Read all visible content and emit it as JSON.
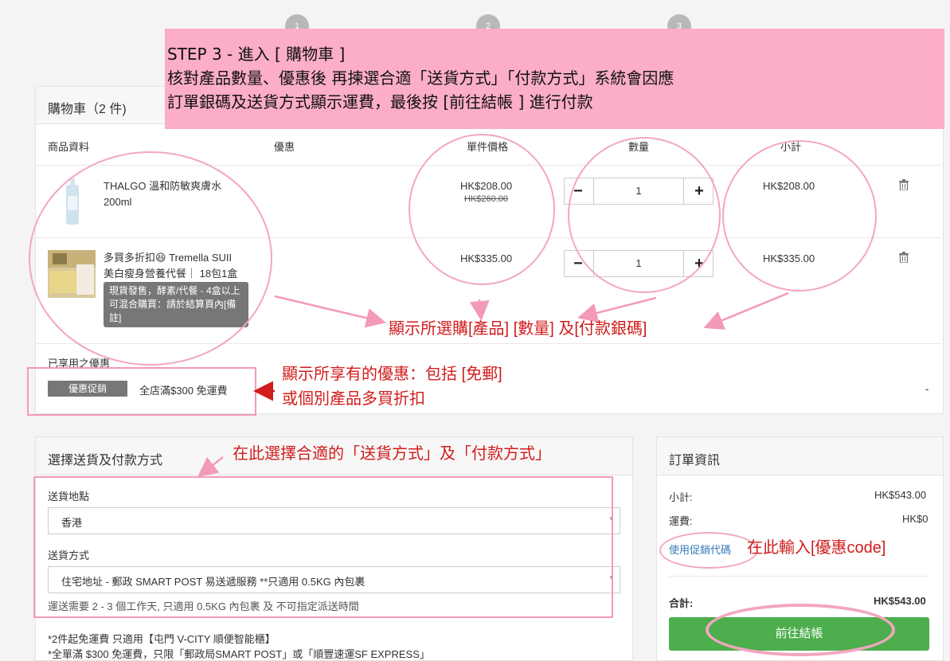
{
  "steps": [
    "1",
    "2",
    "3"
  ],
  "banner": {
    "line1": "STEP 3 - 進入 [ 購物車 ]",
    "line2": "核對產品數量、優惠後 再揀選合適「送貨方式」「付款方式」系統會因應",
    "line3": "訂單銀碼及送貨方式顯示運費，最後按 [前往結帳 ]  進行付款"
  },
  "cart": {
    "title": "購物車（2 件)",
    "col_product": "商品資料",
    "col_discount": "優惠",
    "col_unit_price": "單件價格",
    "col_qty": "數量",
    "col_subtotal": "小計",
    "items": [
      {
        "name": "THALGO 溫和防敏爽膚水 200ml",
        "price": "HK$208.00",
        "orig_price": "HK$260.00",
        "qty": "1",
        "subtotal": "HK$208.00"
      },
      {
        "name_line1": "多買多折扣😆 Tremella SUII",
        "name_line2": "美白瘦身營養代餐｜ 18包1盒",
        "tag": "現貨發售，酵素/代餐 - 4盒以上 可混合購買：請於結算頁內[備註]",
        "price": "HK$335.00",
        "qty": "1",
        "subtotal": "HK$335.00"
      }
    ],
    "applied_label": "已享用之優惠",
    "promo_button": "優惠促銷",
    "promo_text": "全店滿$300 免運費",
    "promo_value": "-"
  },
  "shipping": {
    "title": "選擇送貨及付款方式",
    "location_label": "送貨地點",
    "location_value": "香港",
    "method_label": "送貨方式",
    "method_value": "住宅地址 - 郵政 SMART POST 易送遞服務 **只適用 0.5KG 內包裹",
    "note": "運送需要 2 - 3 個工作天, 只適用 0.5KG 內包裹 及 不可指定派送時間",
    "footer1": "*2件起免運費 只適用【屯門 V-CITY 順便智能櫃】",
    "footer2": "*全單滿 $300 免運費，只限「郵政局SMART POST」或「順豐速運SF EXPRESS」"
  },
  "order": {
    "title": "訂單資訊",
    "subtotal_label": "小計:",
    "subtotal_value": "HK$543.00",
    "shipping_label": "運費:",
    "shipping_value": "HK$0",
    "coupon_link": "使用促銷代碼",
    "total_label": "合計:",
    "total_value": "HK$543.00",
    "checkout_button": "前往結帳"
  },
  "annotations": {
    "show_product": "顯示所選購[產品] [數量] 及[付款銀碼]",
    "show_discount_1": "顯示所享有的優惠：包括 [免郵]",
    "show_discount_2": "或個別產品多買折扣",
    "choose_method": "在此選擇合適的「送貨方式」及「付款方式」",
    "enter_code": "在此輸入[優惠code]"
  },
  "colors": {
    "banner_bg": "#fbadc9",
    "annotation_red": "#d11c1c",
    "annotation_pink": "#f3a6c0",
    "checkout_green": "#4cae4c",
    "link_blue": "#337ab7"
  }
}
